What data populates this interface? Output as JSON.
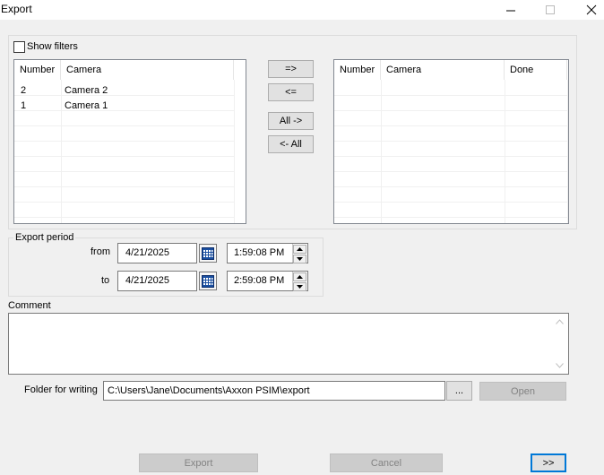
{
  "window": {
    "title": "Export",
    "minimize_glyph": "—",
    "maximize_glyph": "☐",
    "close_glyph": "✕"
  },
  "filters": {
    "show_filters_label": "Show filters",
    "show_filters_checked": false
  },
  "source_list": {
    "columns": [
      "Number",
      "Camera"
    ],
    "rows": [
      {
        "number": "2",
        "camera": "Camera 2"
      },
      {
        "number": "1",
        "camera": "Camera 1"
      }
    ]
  },
  "target_list": {
    "columns": [
      "Number",
      "Camera",
      "Done"
    ],
    "rows": []
  },
  "transfer_buttons": {
    "add": "=>",
    "remove": "<=",
    "add_all": "All ->",
    "remove_all": "<- All"
  },
  "export_period": {
    "group_label": "Export period",
    "from_label": "from",
    "to_label": "to",
    "from_date": "4/21/2025",
    "from_time": "1:59:08 PM",
    "to_date": "4/21/2025",
    "to_time": "2:59:08 PM"
  },
  "comment": {
    "label": "Comment",
    "value": ""
  },
  "folder": {
    "label": "Folder for writing",
    "path": "C:\\Users\\Jane\\Documents\\Axxon PSIM\\export",
    "browse_label": "...",
    "open_label": "Open"
  },
  "footer": {
    "export_label": "Export",
    "cancel_label": "Cancel",
    "more_label": ">>"
  },
  "colors": {
    "accent": "#0078d7",
    "window_bg": "#f0f0f0"
  }
}
